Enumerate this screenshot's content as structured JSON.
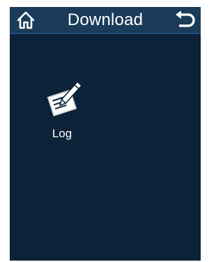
{
  "header": {
    "title": "Download",
    "home_icon": "home-icon",
    "back_icon": "return-icon"
  },
  "items": [
    {
      "label": "Log",
      "icon": "log-notepad-pencil-icon"
    }
  ],
  "colors": {
    "background": "#0c2238",
    "titlebar": "#1a3b59",
    "text": "#ffffff"
  }
}
